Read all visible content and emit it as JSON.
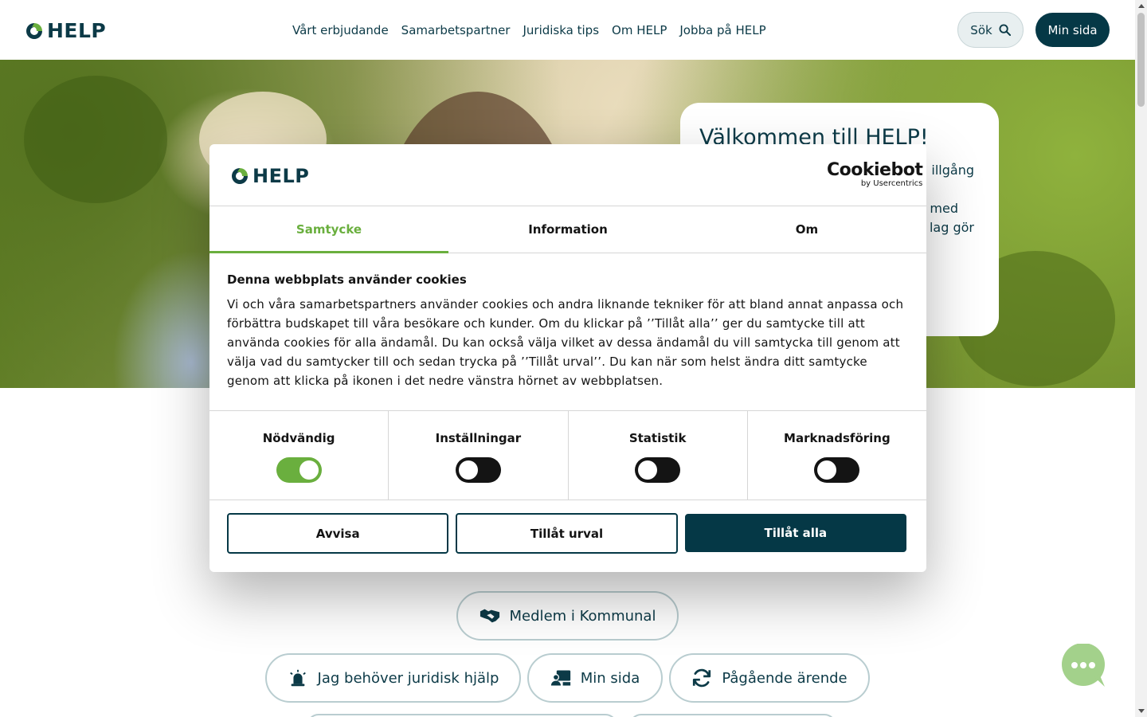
{
  "header": {
    "logo_text": "HELP",
    "nav": [
      "Vårt erbjudande",
      "Samarbetspartner",
      "Juridiska tips",
      "Om HELP",
      "Jobba på HELP"
    ],
    "search_label": "Sök",
    "mypage_label": "Min sida"
  },
  "hero": {
    "welcome_title": "Välkommen till HELP!",
    "welcome_text_visible": [
      "illgång",
      "med",
      "lag gör"
    ]
  },
  "quick_links": {
    "member": "Medlem i Kommunal",
    "legal_help": "Jag behöver juridisk hjälp",
    "mypage": "Min sida",
    "ongoing_case": "Pågående ärende"
  },
  "cookie_dialog": {
    "logo_text": "HELP",
    "provider": "Cookiebot",
    "provider_sub": "by Usercentrics",
    "tabs": [
      {
        "label": "Samtycke",
        "active": true
      },
      {
        "label": "Information",
        "active": false
      },
      {
        "label": "Om",
        "active": false
      }
    ],
    "title": "Denna webbplats använder cookies",
    "text": "Vi och våra samarbetspartners använder cookies och andra liknande tekniker för att bland annat anpassa och förbättra budskapet till våra besökare och kunder. Om du klickar på ’’Tillåt alla’’ ger du samtycke till att använda cookies för alla ändamål. Du kan också välja vilket av dessa ändamål du vill samtycka till genom att välja vad du samtycker till och sedan trycka på ’’Tillåt urval’’. Du kan när som helst ändra ditt samtycke genom att klicka på ikonen i det nedre vänstra hörnet av webbplatsen.",
    "toggles": [
      {
        "label": "Nödvändig",
        "on": true
      },
      {
        "label": "Inställningar",
        "on": false
      },
      {
        "label": "Statistik",
        "on": false
      },
      {
        "label": "Marknadsföring",
        "on": false
      }
    ],
    "buttons": {
      "reject": "Avvisa",
      "allow_selection": "Tillåt urval",
      "allow_all": "Tillåt alla"
    }
  },
  "colors": {
    "brand_dark": "#053846",
    "brand_green": "#6aaf3e",
    "chat_green": "#a3d18b"
  }
}
